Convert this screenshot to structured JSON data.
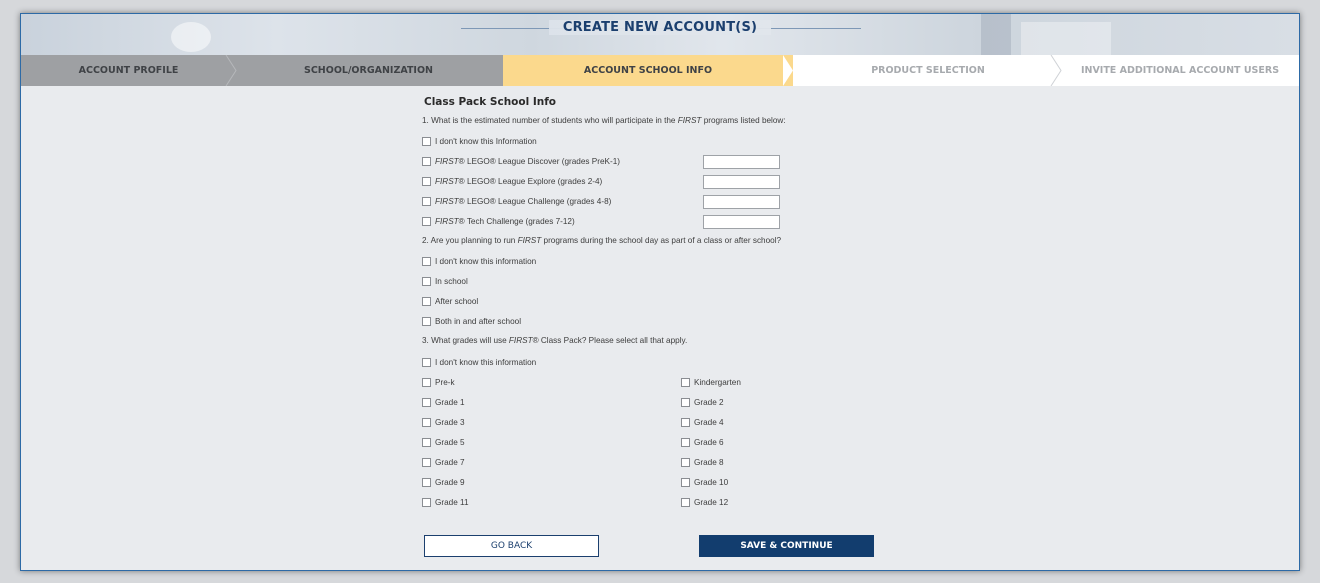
{
  "header": {
    "title": "CREATE NEW ACCOUNT(S)"
  },
  "steps": [
    {
      "label": "ACCOUNT PROFILE"
    },
    {
      "label": "SCHOOL/ORGANIZATION"
    },
    {
      "label": "ACCOUNT SCHOOL INFO"
    },
    {
      "label": "PRODUCT SELECTION"
    },
    {
      "label": "INVITE ADDITIONAL ACCOUNT USERS"
    }
  ],
  "section_title": "Class Pack School Info",
  "q1": {
    "pre": "1. What is the estimated number of students who will participate in the ",
    "em": "FIRST",
    "post": " programs listed below:",
    "dont_know": "I don't know this Information",
    "programs": [
      {
        "em": "FIRST",
        "label": "® LEGO® League Discover (grades PreK-1)",
        "value": ""
      },
      {
        "em": "FIRST",
        "label": "® LEGO® League Explore (grades 2-4)",
        "value": ""
      },
      {
        "em": "FIRST",
        "label": "® LEGO® League Challenge (grades 4-8)",
        "value": ""
      },
      {
        "em": "FIRST",
        "label": "® Tech Challenge (grades 7-12)",
        "value": ""
      }
    ]
  },
  "q2": {
    "pre": "2. Are you planning to run ",
    "em": "FIRST",
    "post": " programs during the school day as part of a class or after school?",
    "options": [
      "I don't know this information",
      "In school",
      "After school",
      "Both in and after school"
    ]
  },
  "q3": {
    "pre": "3. What grades will use ",
    "em": "FIRST",
    "post": "® Class Pack? Please select all that apply.",
    "dont_know": "I don't know this information",
    "left": [
      "Pre-k",
      "Grade 1",
      "Grade 3",
      "Grade 5",
      "Grade 7",
      "Grade 9",
      "Grade 11"
    ],
    "right": [
      "Kindergarten",
      "Grade 2",
      "Grade 4",
      "Grade 6",
      "Grade 8",
      "Grade 10",
      "Grade 12"
    ]
  },
  "buttons": {
    "back": "GO BACK",
    "save": "SAVE & CONTINUE"
  }
}
